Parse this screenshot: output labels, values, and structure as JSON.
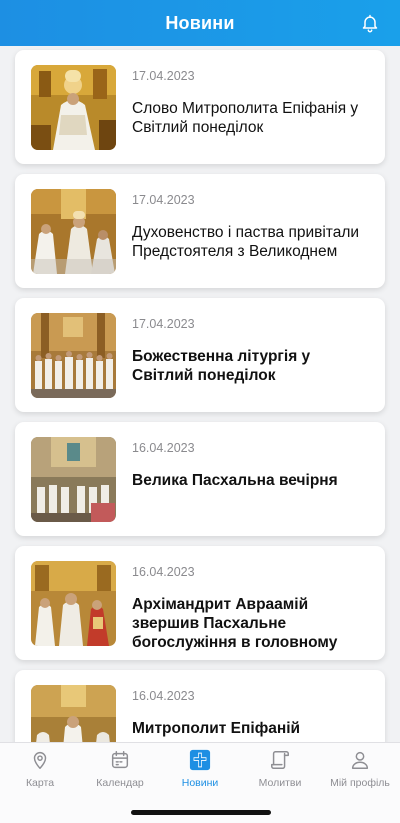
{
  "header": {
    "title": "Новини"
  },
  "news": [
    {
      "date": "17.04.2023",
      "title": "Слово Митрополита Епіфанія у Світлий понеділок"
    },
    {
      "date": "17.04.2023",
      "title": "Духовенство і паства привітали Предстоятеля з Великоднем"
    },
    {
      "date": "17.04.2023",
      "title": "Божественна літургія у Світлий понеділок"
    },
    {
      "date": "16.04.2023",
      "title": "Велика Пасхальна вечірня"
    },
    {
      "date": "16.04.2023",
      "title": "Архімандрит Авраамій звершив Пасхальне богослужіння в головному"
    },
    {
      "date": "16.04.2023",
      "title": "Митрополит Епіфаній звершив"
    }
  ],
  "tabs": [
    {
      "label": "Карта",
      "icon": "map-pin-icon"
    },
    {
      "label": "Календар",
      "icon": "calendar-icon"
    },
    {
      "label": "Новини",
      "icon": "news-cross-icon"
    },
    {
      "label": "Молитви",
      "icon": "scroll-icon"
    },
    {
      "label": "Мій профіль",
      "icon": "person-icon"
    }
  ],
  "colors": {
    "accent": "#1d8fe3",
    "inactive": "#8e8e93"
  }
}
